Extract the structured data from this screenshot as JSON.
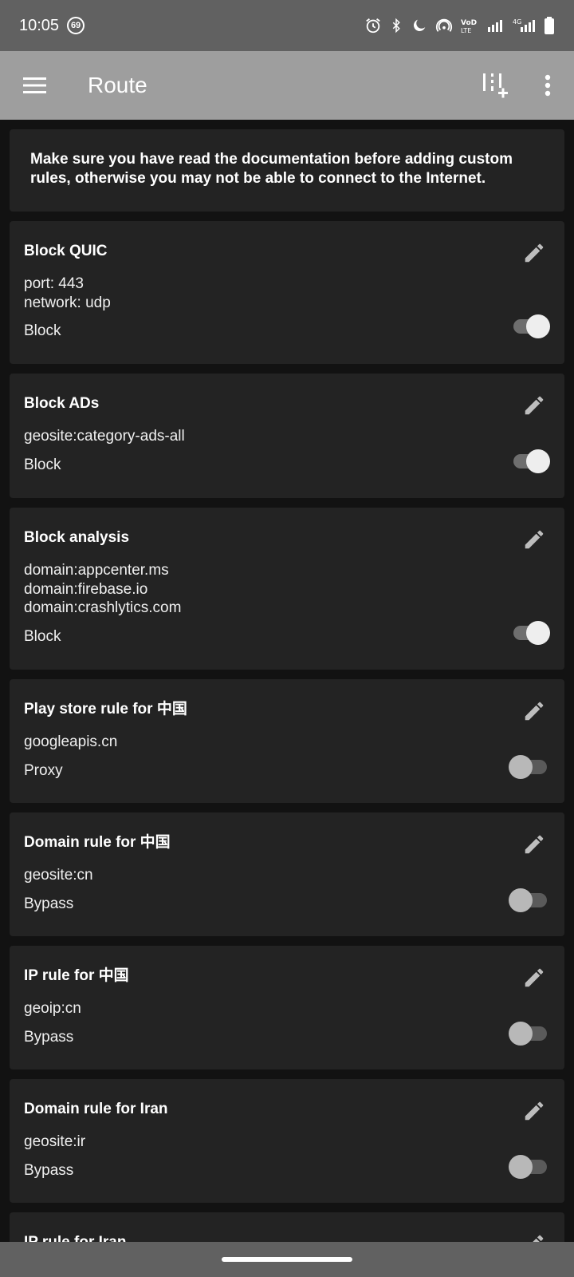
{
  "status": {
    "time": "10:05",
    "notification_count": "69",
    "icons": [
      "alarm-icon",
      "bluetooth-icon",
      "moon-icon",
      "hotspot-icon",
      "volte-icon",
      "signal-icon",
      "signal-4g-icon",
      "battery-icon"
    ]
  },
  "appbar": {
    "title": "Route",
    "icons": [
      "menu-icon",
      "add-rule-icon",
      "more-vert-icon"
    ]
  },
  "notice": "Make sure you have read the documentation before adding custom rules, otherwise you may not be able to connect to the Internet.",
  "rules": [
    {
      "name": "Block QUIC",
      "content": "port: 443\nnetwork: udp",
      "outbound": "Block",
      "enabled": true
    },
    {
      "name": "Block ADs",
      "content": "geosite:category-ads-all",
      "outbound": "Block",
      "enabled": true
    },
    {
      "name": "Block analysis",
      "content": "domain:appcenter.ms\ndomain:firebase.io\ndomain:crashlytics.com",
      "outbound": "Block",
      "enabled": true
    },
    {
      "name": "Play store rule for 中国",
      "content": "googleapis.cn",
      "outbound": "Proxy",
      "enabled": false
    },
    {
      "name": "Domain rule for 中国",
      "content": "geosite:cn",
      "outbound": "Bypass",
      "enabled": false
    },
    {
      "name": "IP rule for 中国",
      "content": "geoip:cn",
      "outbound": "Bypass",
      "enabled": false
    },
    {
      "name": "Domain rule for Iran",
      "content": "geosite:ir",
      "outbound": "Bypass",
      "enabled": false
    },
    {
      "name": "IP rule for Iran",
      "content": "",
      "outbound": "",
      "enabled": false
    }
  ],
  "colors": {
    "appbar": "#9e9e9e",
    "statusbar": "#616161",
    "background": "#121212",
    "card": "#232323"
  }
}
